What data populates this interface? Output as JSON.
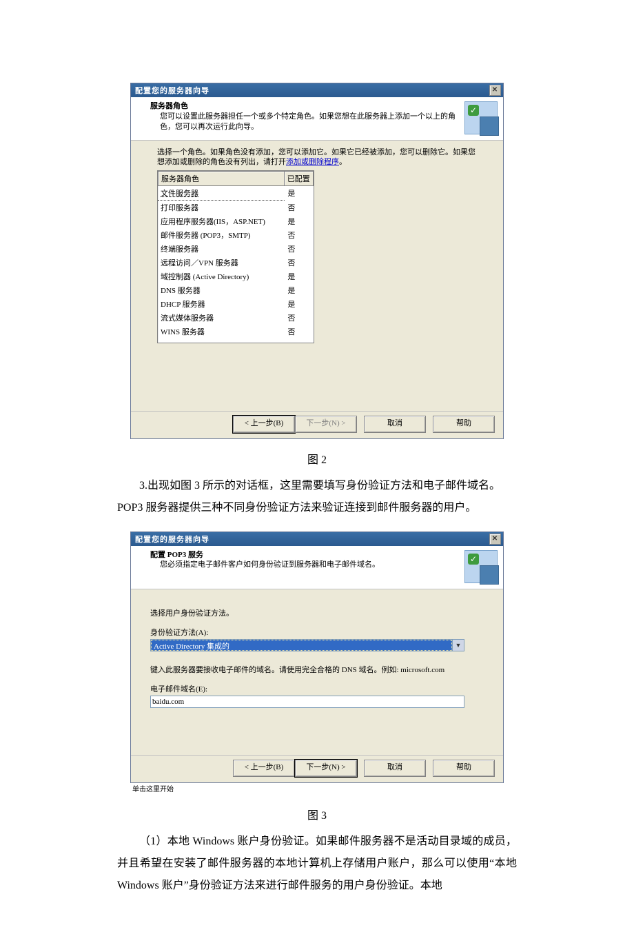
{
  "dlg1": {
    "title": "配置您的服务器向导",
    "header_title": "服务器角色",
    "header_sub": "您可以设置此服务器担任一个或多个特定角色。如果您想在此服务器上添加一个以上的角色，您可以再次运行此向导。",
    "instr1": "选择一个角色。如果角色没有添加，您可以添加它。如果它已经被添加，您可以删除它。如果您想添加或删除的角色没有列出，请打开",
    "instr_link": "添加或删除程序",
    "instr_end": "。",
    "col_name": "服务器角色",
    "col_cfg": "已配置",
    "roles": [
      {
        "name": "文件服务器",
        "cfg": "是"
      },
      {
        "name": "打印服务器",
        "cfg": "否"
      },
      {
        "name": "应用程序服务器(IIS，ASP.NET)",
        "cfg": "是"
      },
      {
        "name": "邮件服务器 (POP3，SMTP)",
        "cfg": "否"
      },
      {
        "name": "终端服务器",
        "cfg": "否"
      },
      {
        "name": "远程访问／VPN 服务器",
        "cfg": "否"
      },
      {
        "name": "域控制器 (Active Directory)",
        "cfg": "是"
      },
      {
        "name": "DNS 服务器",
        "cfg": "是"
      },
      {
        "name": "DHCP 服务器",
        "cfg": "是"
      },
      {
        "name": "流式媒体服务器",
        "cfg": "否"
      },
      {
        "name": "WINS 服务器",
        "cfg": "否"
      }
    ],
    "btn_back": "< 上一步(B)",
    "btn_next": "下一步(N) >",
    "btn_cancel": "取消",
    "btn_help": "帮助"
  },
  "caption1": "图 2",
  "para1": "3.出现如图 3 所示的对话框，这里需要填写身份验证方法和电子邮件域名。POP3 服务器提供三种不同身份验证方法来验证连接到邮件服务器的用户。",
  "dlg2": {
    "title": "配置您的服务器向导",
    "header_title": "配置 POP3 服务",
    "header_sub": "您必须指定电子邮件客户如何身份验证到服务器和电子邮件域名。",
    "lbl_choose": "选择用户身份验证方法。",
    "lbl_auth": "身份验证方法(A):",
    "auth_value": "Active Directory 集成的",
    "lbl_domain_hint": "键入此服务器要接收电子邮件的域名。请使用完全合格的 DNS 域名。例如: microsoft.com",
    "lbl_email": "电子邮件域名(E):",
    "email_value": "baidu.com",
    "foot_note": "单击这里开始",
    "btn_back": "< 上一步(B)",
    "btn_next": "下一步(N) >",
    "btn_cancel": "取消",
    "btn_help": "帮助"
  },
  "caption2": "图 3",
  "para2": "（1）本地 Windows 账户身份验证。如果邮件服务器不是活动目录域的成员，并且希望在安装了邮件服务器的本地计算机上存储用户账户，那么可以使用“本地 Windows 账户”身份验证方法来进行邮件服务的用户身份验证。本地"
}
